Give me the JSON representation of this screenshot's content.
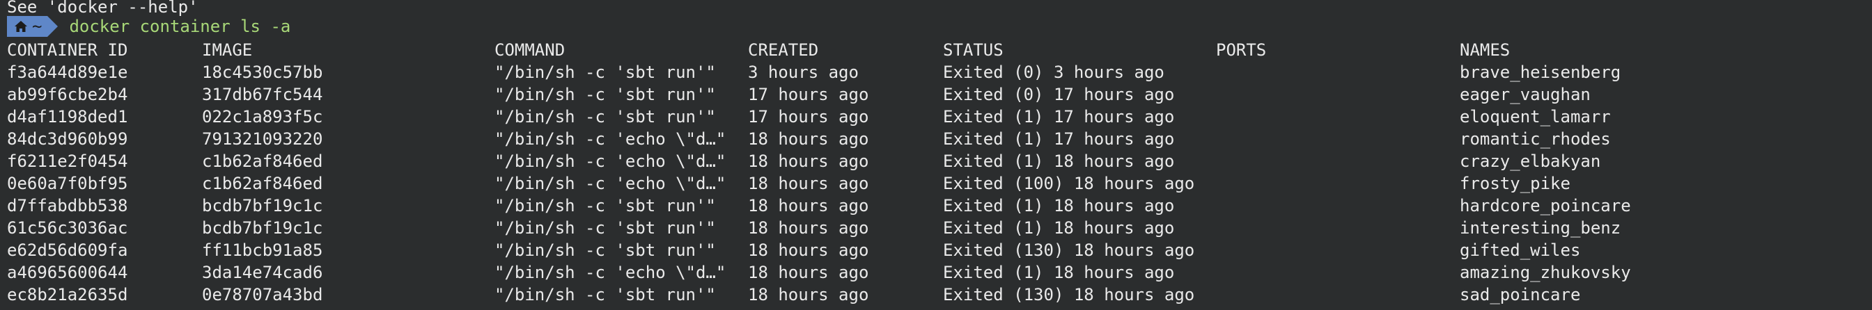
{
  "terminal": {
    "previous_output": "See 'docker --help'",
    "prompt_dir": "~",
    "command": "docker container ls -a"
  },
  "table": {
    "headers": {
      "id": "CONTAINER ID",
      "image": "IMAGE",
      "command": "COMMAND",
      "created": "CREATED",
      "status": "STATUS",
      "ports": "PORTS",
      "names": "NAMES"
    },
    "rows": [
      {
        "id": "f3a644d89e1e",
        "image": "18c4530c57bb",
        "command": "\"/bin/sh -c 'sbt run'\"",
        "created": "3 hours ago",
        "status": "Exited (0) 3 hours ago",
        "ports": "",
        "names": "brave_heisenberg"
      },
      {
        "id": "ab99f6cbe2b4",
        "image": "317db67fc544",
        "command": "\"/bin/sh -c 'sbt run'\"",
        "created": "17 hours ago",
        "status": "Exited (0) 17 hours ago",
        "ports": "",
        "names": "eager_vaughan"
      },
      {
        "id": "d4af1198ded1",
        "image": "022c1a893f5c",
        "command": "\"/bin/sh -c 'sbt run'\"",
        "created": "17 hours ago",
        "status": "Exited (1) 17 hours ago",
        "ports": "",
        "names": "eloquent_lamarr"
      },
      {
        "id": "84dc3d960b99",
        "image": "791321093220",
        "command": "\"/bin/sh -c 'echo \\\"d…\"",
        "created": "18 hours ago",
        "status": "Exited (1) 17 hours ago",
        "ports": "",
        "names": "romantic_rhodes"
      },
      {
        "id": "f6211e2f0454",
        "image": "c1b62af846ed",
        "command": "\"/bin/sh -c 'echo \\\"d…\"",
        "created": "18 hours ago",
        "status": "Exited (1) 18 hours ago",
        "ports": "",
        "names": "crazy_elbakyan"
      },
      {
        "id": "0e60a7f0bf95",
        "image": "c1b62af846ed",
        "command": "\"/bin/sh -c 'echo \\\"d…\"",
        "created": "18 hours ago",
        "status": "Exited (100) 18 hours ago",
        "ports": "",
        "names": "frosty_pike"
      },
      {
        "id": "d7ffabdbb538",
        "image": "bcdb7bf19c1c",
        "command": "\"/bin/sh -c 'sbt run'\"",
        "created": "18 hours ago",
        "status": "Exited (1) 18 hours ago",
        "ports": "",
        "names": "hardcore_poincare"
      },
      {
        "id": "61c56c3036ac",
        "image": "bcdb7bf19c1c",
        "command": "\"/bin/sh -c 'sbt run'\"",
        "created": "18 hours ago",
        "status": "Exited (1) 18 hours ago",
        "ports": "",
        "names": "interesting_benz"
      },
      {
        "id": "e62d56d609fa",
        "image": "ff11bcb91a85",
        "command": "\"/bin/sh -c 'sbt run'\"",
        "created": "18 hours ago",
        "status": "Exited (130) 18 hours ago",
        "ports": "",
        "names": "gifted_wiles"
      },
      {
        "id": "a46965600644",
        "image": "3da14e74cad6",
        "command": "\"/bin/sh -c 'echo \\\"d…\"",
        "created": "18 hours ago",
        "status": "Exited (1) 18 hours ago",
        "ports": "",
        "names": "amazing_zhukovsky"
      },
      {
        "id": "ec8b21a2635d",
        "image": "0e78707a43bd",
        "command": "\"/bin/sh -c 'sbt run'\"",
        "created": "18 hours ago",
        "status": "Exited (130) 18 hours ago",
        "ports": "",
        "names": "sad_poincare"
      }
    ]
  },
  "colors": {
    "background": "#2b2d2e",
    "text": "#eaeaea",
    "prompt_bg": "#5f87c8",
    "command": "#a8d878"
  }
}
